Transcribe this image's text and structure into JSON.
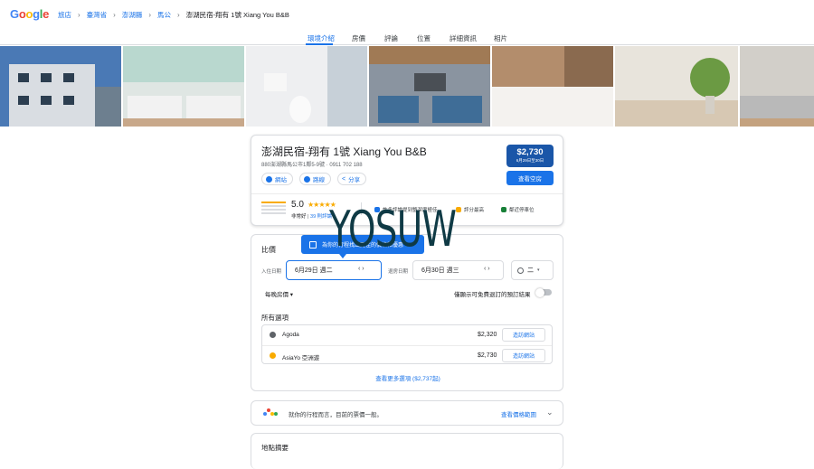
{
  "logo": {
    "letters": [
      "G",
      "o",
      "o",
      "g",
      "l",
      "e"
    ],
    "colors": [
      "#4285f4",
      "#ea4335",
      "#fbbc05",
      "#4285f4",
      "#34a853",
      "#ea4335"
    ]
  },
  "breadcrumb": {
    "items": [
      "旅店",
      "臺灣省",
      "澎湖縣",
      "馬公"
    ],
    "current": "澎湖民宿-翔有 1號 Xiang You B&B"
  },
  "tabs": [
    "環境介紹",
    "房價",
    "評論",
    "位置",
    "詳細資訊",
    "相片"
  ],
  "photos": [
    "#3b5f8f",
    "#c9d6d2",
    "#e7e8ea",
    "#5d6b7b",
    "#8c6b52",
    "#d8d2c8",
    "#bfc3c4"
  ],
  "hotel": {
    "title": "澎湖民宿-翔有 1號 Xiang You B&B",
    "address": "880澎湖縣馬公市1鄰5-9號 · 0911 702 188",
    "chips": [
      "網站",
      "路線",
      "分享"
    ],
    "price": "$2,730",
    "price_dates": "6月29日至30日",
    "book_label": "查看空房",
    "score": "5.0",
    "stars": "★★★★★",
    "rating_text": "非常好",
    "reviews_link": "39 則評論",
    "amenities": [
      "許多評論提到整潔度極佳",
      "評分最高",
      "鄰近停車位"
    ],
    "amenity_colors": [
      "#1a73e8",
      "#f9ab00",
      "#188038"
    ]
  },
  "watermark": "YOSUW",
  "compare": {
    "title": "比價",
    "tooltip": "為你的行程找出更佳的價格和優惠",
    "checkin_label": "入住日期",
    "checkin_value": "6月29日 週二",
    "checkout_label": "退房日期",
    "checkout_value": "6月30日 週三",
    "arrows": "‹  ›",
    "guests": "二",
    "per_night": "每晚房價 ▾",
    "free_cancel": "僅顯示可免費退訂的預訂結果",
    "all_options": "所有選項",
    "options": [
      {
        "name": "Agoda",
        "price": "$2,320",
        "button": "造訪網站",
        "color": "#5f6368"
      },
      {
        "name": "AsiaYo 亞洲遊",
        "price": "$2,730",
        "button": "造訪網站",
        "color": "#f9ab00"
      }
    ],
    "more": "查看更多選項 ($2,737起)"
  },
  "insight": {
    "text": "就你的行程而言，目前的票價一般。",
    "link": "查看價格範圍",
    "chevron": "⌄",
    "dot_colors": [
      "#4285f4",
      "#ea4335",
      "#fbbc05",
      "#34a853"
    ]
  },
  "location": {
    "title": "地點摘要"
  }
}
